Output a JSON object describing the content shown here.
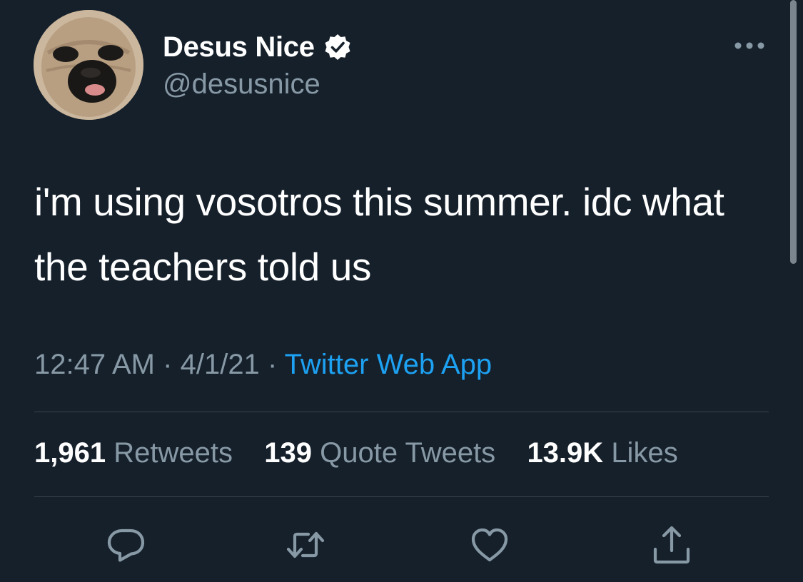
{
  "tweet": {
    "display_name": "Desus Nice",
    "handle": "@desusnice",
    "text": "i'm using vosotros this summer. idc what the teachers told us",
    "time": "12:47 AM",
    "date": "4/1/21",
    "separator": "·",
    "source": "Twitter Web App",
    "verified": true
  },
  "stats": {
    "retweets_count": "1,961",
    "retweets_label": "Retweets",
    "quotes_count": "139",
    "quotes_label": "Quote Tweets",
    "likes_count": "13.9K",
    "likes_label": "Likes"
  },
  "actions": [
    "reply-icon",
    "retweet-icon",
    "like-icon",
    "share-icon"
  ],
  "colors": {
    "background": "#15202b",
    "secondary_text": "#8899a6",
    "accent": "#1da1f2",
    "divider": "#38444d"
  }
}
